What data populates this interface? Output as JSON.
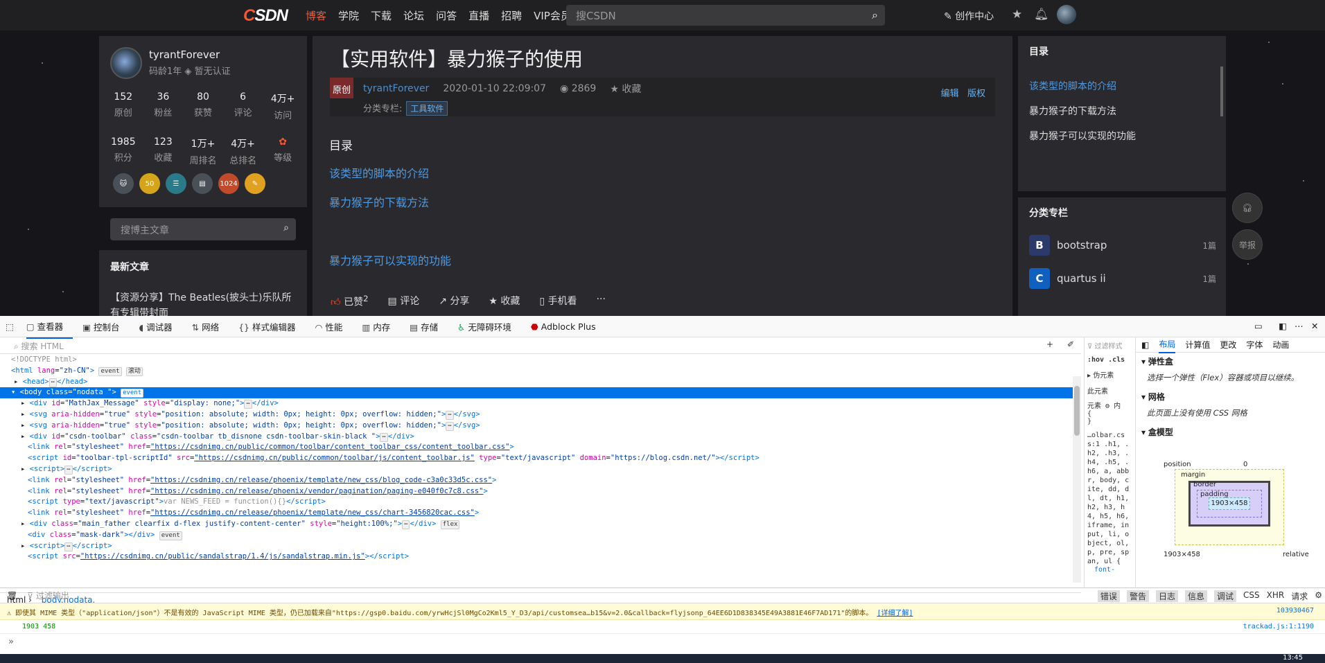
{
  "topnav": {
    "logo": "CSDN",
    "items": [
      "博客",
      "学院",
      "下载",
      "论坛",
      "问答",
      "直播",
      "招聘",
      "VIP会员"
    ],
    "search_placeholder": "搜CSDN",
    "create": "创作中心"
  },
  "profile": {
    "name": "tyrantForever",
    "age": "码龄1年",
    "cert": "暂无认证",
    "stats1": [
      {
        "v": "152",
        "l": "原创"
      },
      {
        "v": "36",
        "l": "粉丝"
      },
      {
        "v": "80",
        "l": "获赞"
      },
      {
        "v": "6",
        "l": "评论"
      },
      {
        "v": "4万+",
        "l": "访问"
      }
    ],
    "stats2": [
      {
        "v": "1985",
        "l": "积分"
      },
      {
        "v": "123",
        "l": "收藏"
      },
      {
        "v": "1万+",
        "l": "周排名"
      },
      {
        "v": "4万+",
        "l": "总排名"
      },
      {
        "v": "",
        "l": "等级"
      }
    ]
  },
  "blog_search_placeholder": "搜博主文章",
  "latest": {
    "title": "最新文章",
    "item": "【资源分享】The Beatles(披头士)乐队所有专辑带封面"
  },
  "article": {
    "title": "【实用软件】暴力猴子的使用",
    "badge": "原创",
    "author": "tyrantForever",
    "date": "2020-01-10 22:09:07",
    "views": "2869",
    "fav": "收藏",
    "col_label": "分类专栏:",
    "col_tag": "工具软件",
    "edit": "编辑",
    "copyright": "版权",
    "toc_title": "目录",
    "toc": [
      "该类型的脚本的介绍",
      "暴力猴子的下载方法",
      "暴力猴子可以实现的功能"
    ],
    "actions": {
      "liked": "已赞",
      "liked_count": "2",
      "comment": "评论",
      "share": "分享",
      "fav": "收藏",
      "mobile": "手机看",
      "more": "···"
    }
  },
  "right_toc": {
    "title": "目录",
    "items": [
      "该类型的脚本的介绍",
      "暴力猴子的下载方法",
      "暴力猴子可以实现的功能"
    ]
  },
  "columns": {
    "title": "分类专栏",
    "items": [
      {
        "name": "bootstrap",
        "count": "1篇"
      },
      {
        "name": "quartus ii",
        "count": "1篇"
      }
    ]
  },
  "float": {
    "report": "举报"
  },
  "devtools": {
    "tabs": [
      "查看器",
      "控制台",
      "调试器",
      "网络",
      "样式编辑器",
      "性能",
      "内存",
      "存储",
      "无障碍环境",
      "Adblock Plus"
    ],
    "search_html": "搜索 HTML",
    "filter_styles": "过滤样式",
    "hov": ":hov",
    "cls": ".cls",
    "pseudo": "伪元素",
    "this_el": "此元素",
    "element": "元素",
    "inner": "内",
    "rules_text": "…olbar.css:1 .h1, .h2, .h3, .h4, .h5, .h6, a, abbr, body, cite, dd, dl, dt, h1, h2, h3, h4, h5, h6, iframe, input, li, object, ol, p, pre, span, ul {",
    "rules_font": "font-",
    "breadcrumb": [
      "html",
      "body.nodata."
    ],
    "layout_tabs": [
      "布局",
      "计算值",
      "更改",
      "字体",
      "动画"
    ],
    "flex_title": "弹性盒",
    "flex_note": "选择一个弹性（Flex）容器或项目以继续。",
    "grid_title": "网格",
    "grid_note": "此页面上没有使用 CSS 网格",
    "boxmodel_title": "盒模型",
    "bm": {
      "position": "position",
      "margin": "margin",
      "border": "border",
      "padding": "padding",
      "content": "1903×458",
      "zero": "0",
      "size": "1903×458",
      "pos": "relative"
    },
    "console_filter": "过滤输出",
    "console_levels": [
      "错误",
      "警告",
      "日志",
      "信息",
      "调试",
      "CSS",
      "XHR",
      "请求"
    ],
    "warning": "即使其 MIME 类型（\"application/json\"）不是有效的 JavaScript MIME 类型，仍已加载来自\"https://gsp0.baidu.com/yrwHcjSl0MgCo2Kml5_Y_D3/api/customsea…b15&v=2.0&callback=flyjsonp_64EE6D1D838345E49A3881E46F7AD171\"的脚本。",
    "warning_link": "[详细了解]",
    "warning_src": "103930467",
    "log": "1903 458",
    "log_src": "trackad.js:1:1190",
    "prompt": "»"
  },
  "clock": "13:45"
}
